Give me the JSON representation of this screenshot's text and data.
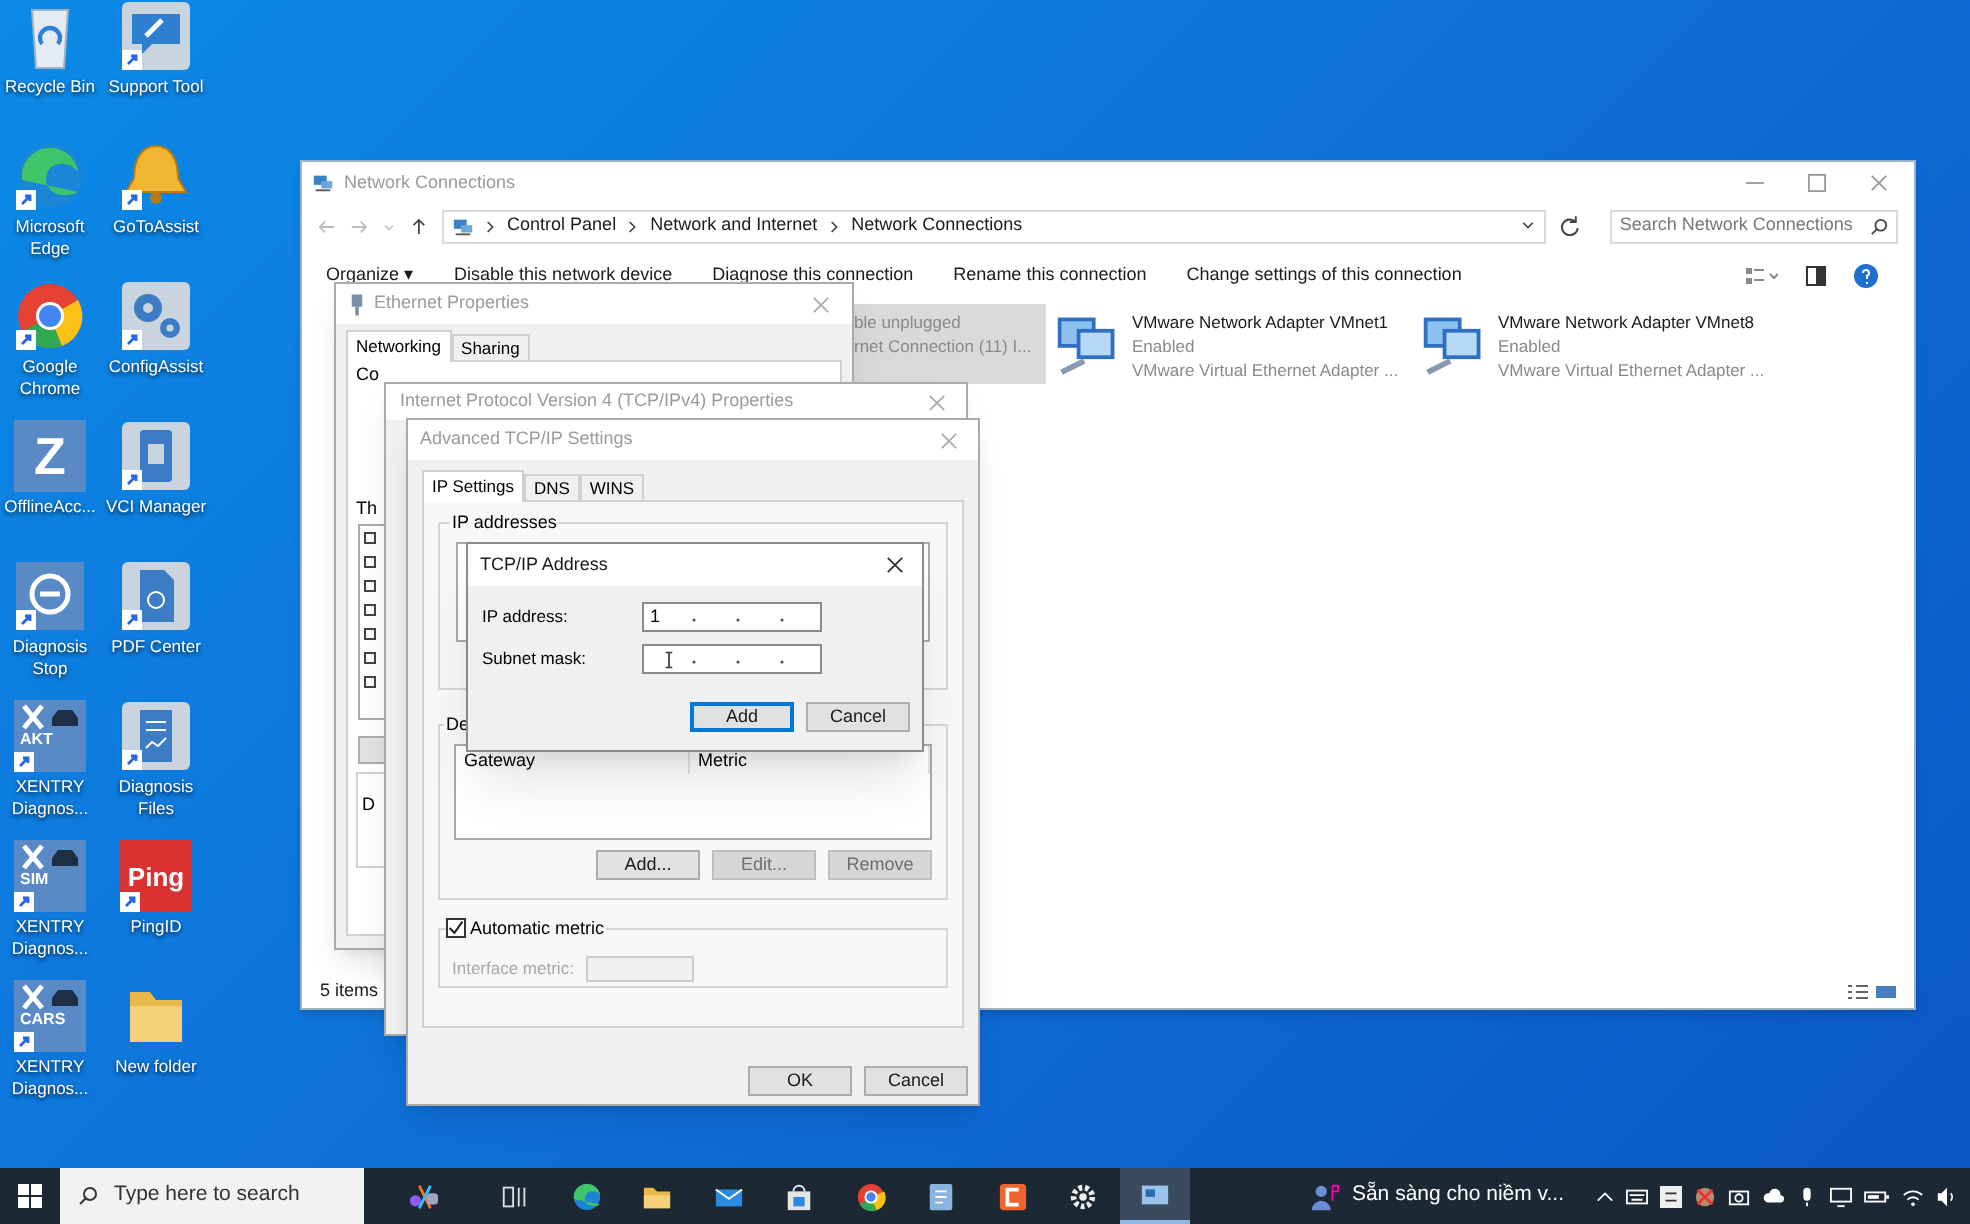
{
  "desktop_icons": [
    {
      "label": "Recycle Bin",
      "kind": "recycle"
    },
    {
      "label": "Support Tool",
      "kind": "tool"
    },
    {
      "label": "Microsoft Edge",
      "kind": "edge"
    },
    {
      "label": "GoToAssist",
      "kind": "bell"
    },
    {
      "label": "Google Chrome",
      "kind": "chrome"
    },
    {
      "label": "ConfigAssist",
      "kind": "gears"
    },
    {
      "label": "OfflineAcc...",
      "kind": "letter",
      "badge": "Z"
    },
    {
      "label": "VCI Manager",
      "kind": "vci"
    },
    {
      "label": "Diagnosis Stop",
      "kind": "stop"
    },
    {
      "label": "PDF Center",
      "kind": "pdf"
    },
    {
      "label": "XENTRY Diagnos...",
      "kind": "xentry",
      "badge": "AKT"
    },
    {
      "label": "Diagnosis Files",
      "kind": "files"
    },
    {
      "label": "XENTRY Diagnos...",
      "kind": "xentry",
      "badge": "SIM"
    },
    {
      "label": "PingID",
      "kind": "ping",
      "badge": "Ping"
    },
    {
      "label": "XENTRY Diagnos...",
      "kind": "xentry",
      "badge": "CARS"
    },
    {
      "label": "New folder",
      "kind": "folder"
    }
  ],
  "network_window": {
    "title": "Network Connections",
    "path": [
      "Control Panel",
      "Network and Internet",
      "Network Connections"
    ],
    "search": {
      "placeholder": "Search Network Connections"
    },
    "commands": [
      "Organize ▾",
      "Disable this network device",
      "Diagnose this connection",
      "Rename this connection",
      "Change settings of this connection"
    ],
    "adapters": [
      {
        "status": "ble unplugged",
        "device": "rnet Connection (11) I...",
        "selected": true
      },
      {
        "name": "VMware Network Adapter VMnet1",
        "status": "Enabled",
        "device": "VMware Virtual Ethernet Adapter ...",
        "selected": false
      },
      {
        "name": "VMware Network Adapter VMnet8",
        "status": "Enabled",
        "device": "VMware Virtual Ethernet Adapter ...",
        "selected": false
      }
    ],
    "status_bar": "5 items"
  },
  "ethernet_properties": {
    "title": "Ethernet Properties",
    "tabs": [
      {
        "label": "Networking",
        "selected": true
      },
      {
        "label": "Sharing",
        "selected": false
      }
    ],
    "fragments": [
      "Co",
      "Th",
      "D"
    ]
  },
  "ipv4_properties": {
    "title": "Internet Protocol Version 4 (TCP/IPv4) Properties"
  },
  "advanced_tcpip": {
    "title": "Advanced TCP/IP Settings",
    "tabs": [
      {
        "label": "IP Settings",
        "selected": true
      },
      {
        "label": "DNS",
        "selected": false
      },
      {
        "label": "WINS",
        "selected": false
      }
    ],
    "ip_group": "IP addresses",
    "gateway_group": "De",
    "gateway_columns": [
      "Gateway",
      "Metric"
    ],
    "gateway_buttons": [
      {
        "label": "Add...",
        "disabled": false
      },
      {
        "label": "Edit...",
        "disabled": true
      },
      {
        "label": "Remove",
        "disabled": true
      }
    ],
    "automatic_metric": {
      "label": "Automatic metric",
      "checked": true
    },
    "interface_metric": {
      "label": "Interface metric:",
      "disabled": true
    },
    "buttons": [
      "OK",
      "Cancel"
    ]
  },
  "tcpip_address": {
    "title": "TCP/IP Address",
    "fields": [
      {
        "label": "IP address:",
        "value": "1"
      },
      {
        "label": "Subnet mask:"
      }
    ],
    "buttons": [
      {
        "label": "Add",
        "default": true
      },
      {
        "label": "Cancel",
        "default": false
      }
    ]
  },
  "taskbar": {
    "search": {
      "placeholder": "Type here to search"
    },
    "apps": [
      {
        "kind": "assistant",
        "selected": false
      },
      {
        "kind": "taskview",
        "selected": false
      },
      {
        "kind": "edge",
        "selected": false
      },
      {
        "kind": "folder",
        "selected": false
      },
      {
        "kind": "mail",
        "selected": false
      },
      {
        "kind": "store",
        "selected": false
      },
      {
        "kind": "chrome",
        "selected": false
      },
      {
        "kind": "doc",
        "selected": false
      },
      {
        "kind": "orange",
        "selected": false
      },
      {
        "kind": "gear",
        "selected": false
      },
      {
        "kind": "network",
        "selected": true
      }
    ],
    "notification": "Sẵn sàng cho niềm v..."
  }
}
